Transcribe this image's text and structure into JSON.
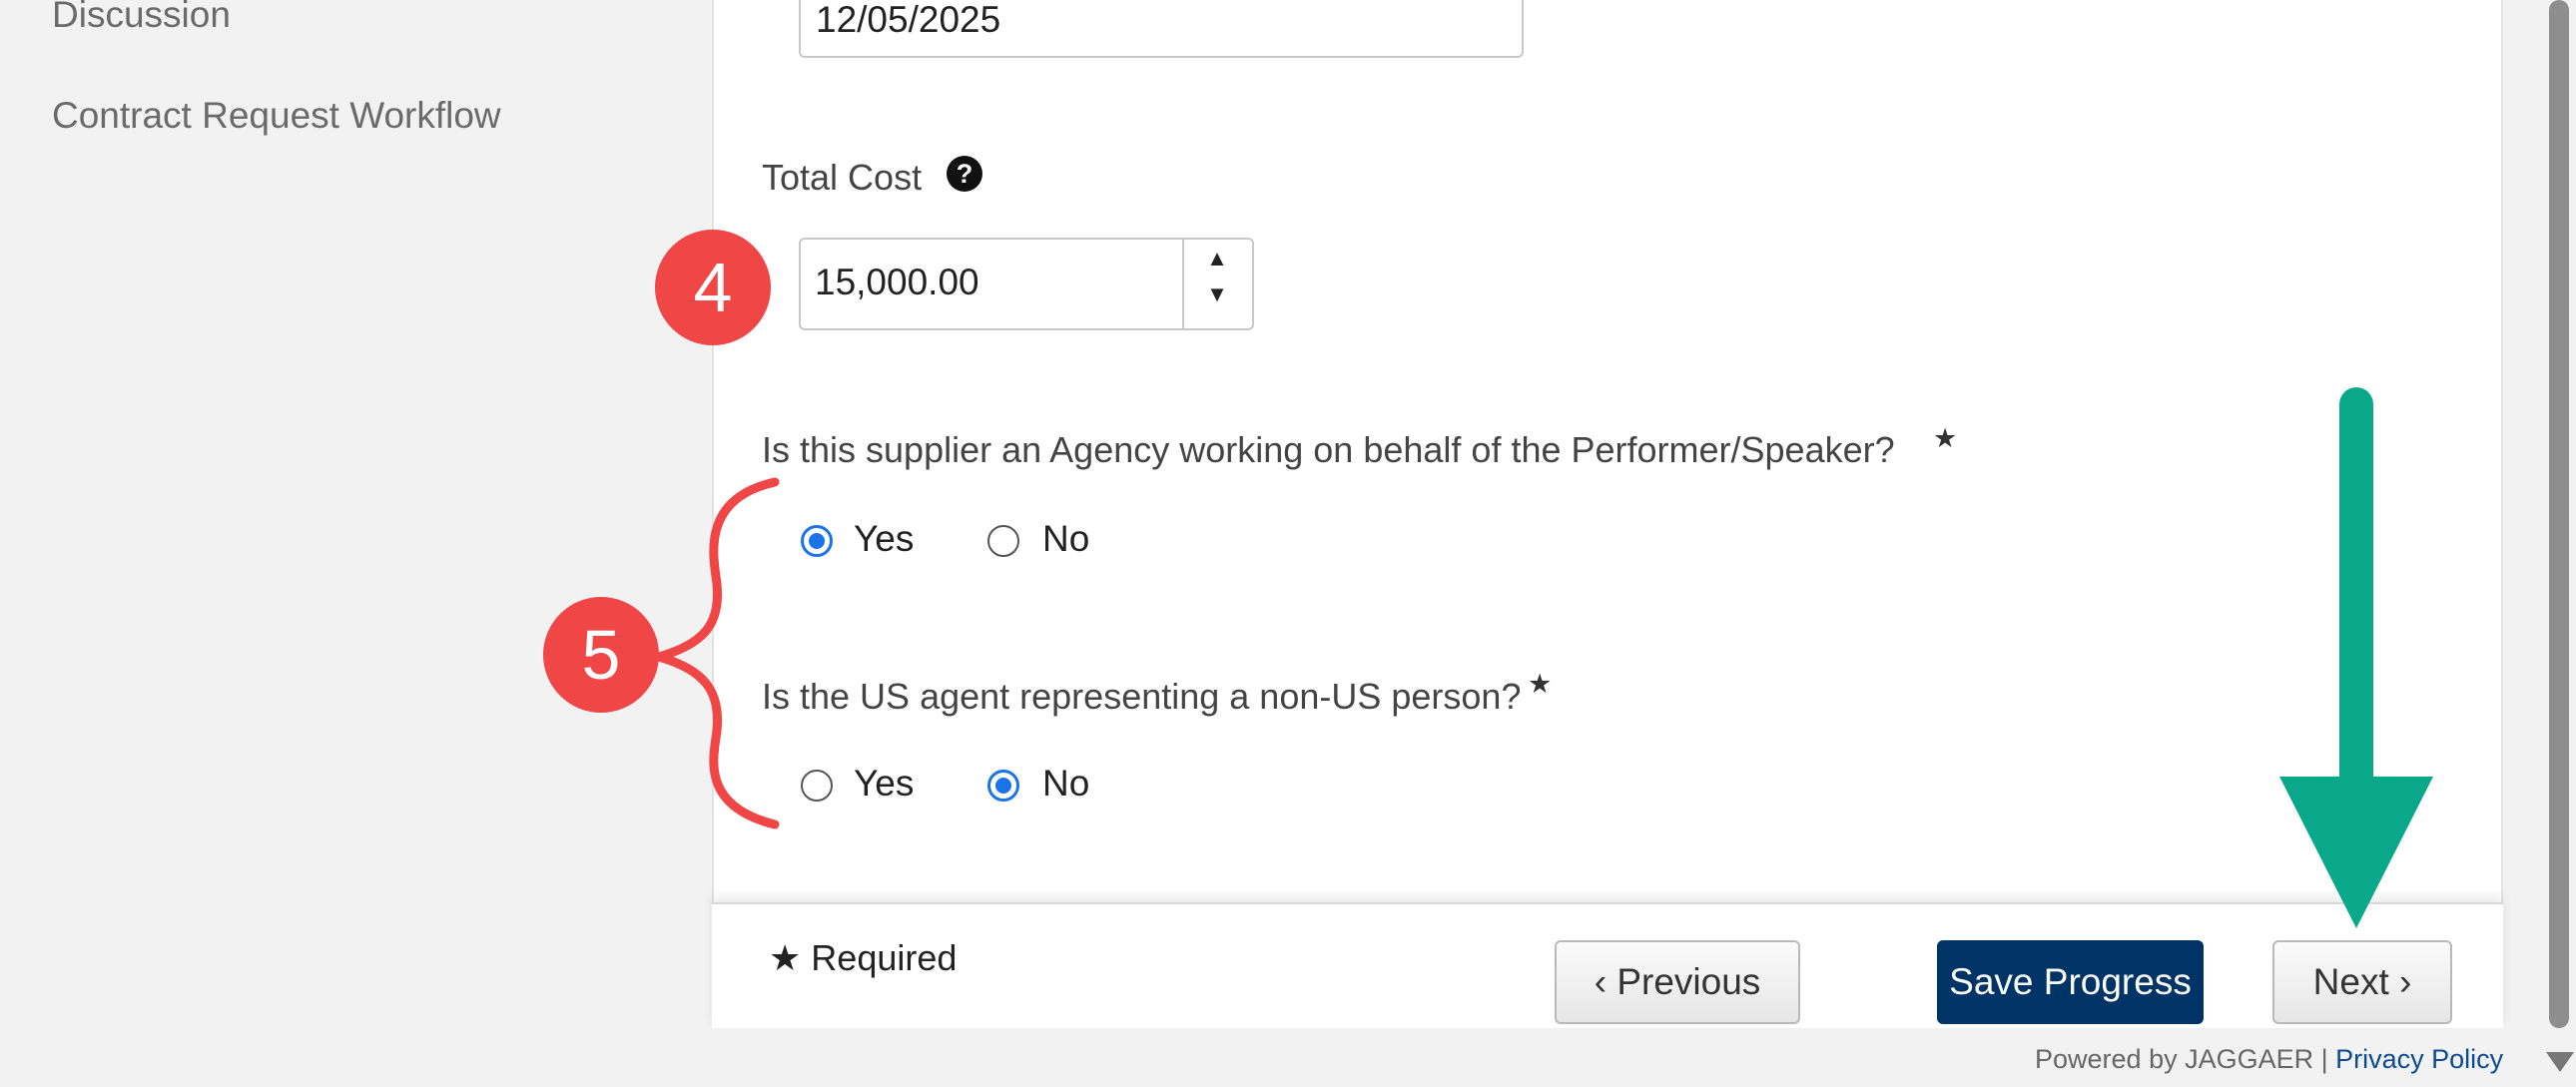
{
  "sidebar": {
    "items": [
      {
        "label": "Discussion"
      },
      {
        "label": "Contract Request Workflow"
      }
    ]
  },
  "form": {
    "date_value": "12/05/2025",
    "total_cost": {
      "label": "Total Cost",
      "help_icon": "?",
      "value": "15,000.00",
      "spin_up": "▲",
      "spin_down": "▼"
    },
    "questions": [
      {
        "label": "Is this supplier an Agency working on behalf of the Performer/Speaker?",
        "required_star": "★",
        "options": [
          "Yes",
          "No"
        ],
        "selected": "Yes"
      },
      {
        "label": "Is the US agent representing a non-US person?",
        "required_star": "★",
        "options": [
          "Yes",
          "No"
        ],
        "selected": "No"
      }
    ]
  },
  "footer": {
    "required_star": "★",
    "required_label": "Required",
    "previous_label": "‹ Previous",
    "save_label": "Save Progress",
    "next_label": "Next ›",
    "powered_by": "Powered by JAGGAER |",
    "privacy_label": "Privacy Policy"
  },
  "annotations": {
    "badge_4": "4",
    "badge_5": "5",
    "colors": {
      "badge": "#f04646",
      "arrow": "#0aa88a"
    }
  },
  "colors": {
    "primary_button": "#003366",
    "radio_selected": "#1a73e8",
    "link": "#0b4a92"
  }
}
